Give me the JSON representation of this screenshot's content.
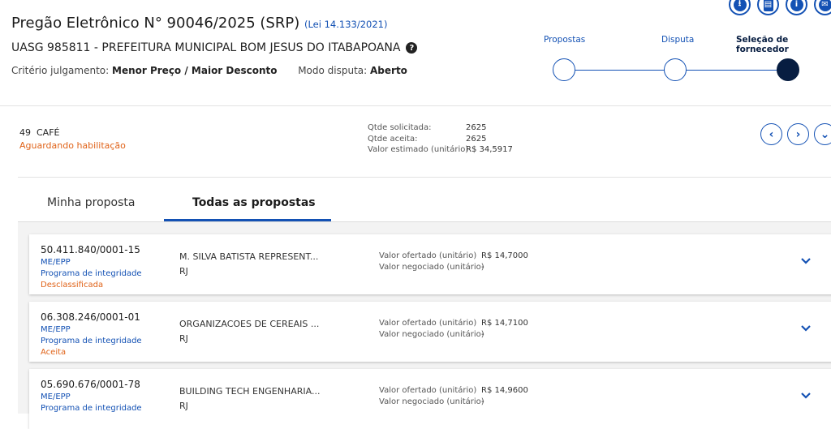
{
  "header": {
    "title": "Pregão Eletrônico N° 90046/2025 (SRP)",
    "law_link": "(Lei 14.133/2021)",
    "uasg": "UASG 985811 - PREFEITURA MUNICIPAL BOM JESUS DO ITABAPOANA",
    "criteria_label": "Critério julgamento:",
    "criteria_value": "Menor Preço / Maior Desconto",
    "mode_label": "Modo disputa:",
    "mode_value": "Aberto",
    "accent_color": "#1351b4",
    "top_icons": [
      "download-icon",
      "clipboard-icon",
      "info-icon",
      "mail-icon"
    ]
  },
  "stepper": {
    "steps": [
      {
        "label": "Propostas",
        "state": "pending"
      },
      {
        "label": "Disputa",
        "state": "pending"
      },
      {
        "label": "Seleção de fornecedor",
        "state": "active"
      }
    ]
  },
  "item": {
    "number": "49",
    "name": "CAFÉ",
    "status": "Aguardando habilitação",
    "qty_requested_label": "Qtde solicitada:",
    "qty_requested": "2625",
    "qty_accepted_label": "Qtde aceita:",
    "qty_accepted": "2625",
    "estimated_label": "Valor estimado (unitário)",
    "estimated_value": "R$ 34,5917"
  },
  "tabs": [
    {
      "label": "Minha proposta",
      "active": false
    },
    {
      "label": "Todas as propostas",
      "active": true
    }
  ],
  "proposals": [
    {
      "cnpj": "50.411.840/0001-15",
      "size": "ME/EPP",
      "integrity": "Programa de integridade",
      "status": "Desclassificada",
      "company": "M. SILVA BATISTA REPRESENT...",
      "uf": "RJ",
      "offered_label": "Valor ofertado (unitário)",
      "offered_value": "R$ 14,7000",
      "negotiated_label": "Valor negociado (unitário)",
      "negotiated_value": "-"
    },
    {
      "cnpj": "06.308.246/0001-01",
      "size": "ME/EPP",
      "integrity": "Programa de integridade",
      "status": "Aceita",
      "company": "ORGANIZACOES DE CEREAIS ...",
      "uf": "RJ",
      "offered_label": "Valor ofertado (unitário)",
      "offered_value": "R$ 14,7100",
      "negotiated_label": "Valor negociado (unitário)",
      "negotiated_value": "-"
    },
    {
      "cnpj": "05.690.676/0001-78",
      "size": "ME/EPP",
      "integrity": "Programa de integridade",
      "status": "",
      "company": "BUILDING TECH ENGENHARIA...",
      "uf": "RJ",
      "offered_label": "Valor ofertado (unitário)",
      "offered_value": "R$ 14,9600",
      "negotiated_label": "Valor negociado (unitário)",
      "negotiated_value": "-"
    }
  ]
}
